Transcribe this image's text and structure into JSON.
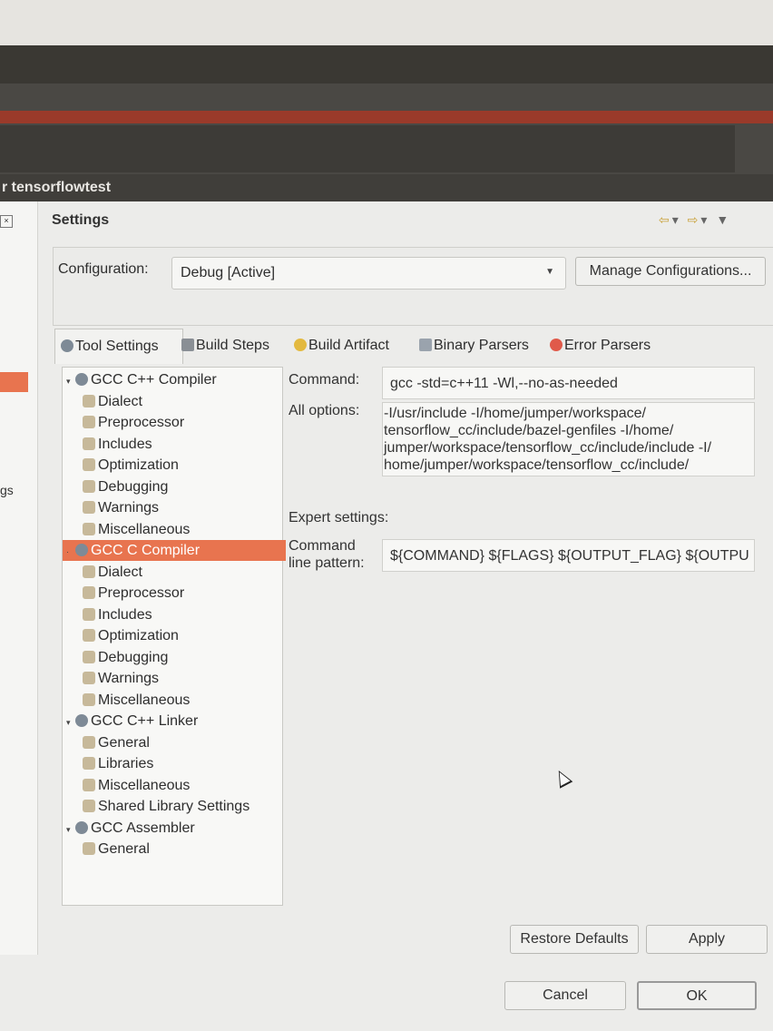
{
  "window": {
    "title": "r tensorflowtest"
  },
  "left_panel": {
    "partial_label": "gs"
  },
  "page": {
    "title": "Settings"
  },
  "configuration": {
    "label": "Configuration:",
    "value": "Debug [Active]",
    "manage_button": "Manage Configurations..."
  },
  "tabs": [
    {
      "label": "Tool Settings",
      "icon": "tool-settings-icon"
    },
    {
      "label": "Build Steps",
      "icon": "build-steps-icon"
    },
    {
      "label": "Build Artifact",
      "icon": "build-artifact-icon"
    },
    {
      "label": "Binary Parsers",
      "icon": "binary-parsers-icon"
    },
    {
      "label": "Error Parsers",
      "icon": "error-parsers-icon"
    }
  ],
  "tree": [
    {
      "label": "GCC C++ Compiler",
      "level": 0,
      "expanded": true
    },
    {
      "label": "Dialect",
      "level": 1
    },
    {
      "label": "Preprocessor",
      "level": 1
    },
    {
      "label": "Includes",
      "level": 1
    },
    {
      "label": "Optimization",
      "level": 1
    },
    {
      "label": "Debugging",
      "level": 1
    },
    {
      "label": "Warnings",
      "level": 1
    },
    {
      "label": "Miscellaneous",
      "level": 1
    },
    {
      "label": "GCC C Compiler",
      "level": 0,
      "selected": true
    },
    {
      "label": "Dialect",
      "level": 1
    },
    {
      "label": "Preprocessor",
      "level": 1
    },
    {
      "label": "Includes",
      "level": 1
    },
    {
      "label": "Optimization",
      "level": 1
    },
    {
      "label": "Debugging",
      "level": 1
    },
    {
      "label": "Warnings",
      "level": 1
    },
    {
      "label": "Miscellaneous",
      "level": 1
    },
    {
      "label": "GCC C++ Linker",
      "level": 0,
      "expanded": true
    },
    {
      "label": "General",
      "level": 1
    },
    {
      "label": "Libraries",
      "level": 1
    },
    {
      "label": "Miscellaneous",
      "level": 1
    },
    {
      "label": "Shared Library Settings",
      "level": 1
    },
    {
      "label": "GCC Assembler",
      "level": 0,
      "expanded": true
    },
    {
      "label": "General",
      "level": 1
    }
  ],
  "props": {
    "command_label": "Command:",
    "command_value": "gcc -std=c++11 -Wl,--no-as-needed",
    "all_options_label": "All options:",
    "all_options_lines": [
      "-I/usr/include -I/home/jumper/workspace/",
      "tensorflow_cc/include/bazel-genfiles -I/home/",
      "jumper/workspace/tensorflow_cc/include/include -I/",
      "home/jumper/workspace/tensorflow_cc/include/"
    ],
    "expert_label": "Expert settings:",
    "pattern_label_1": "Command",
    "pattern_label_2": "line pattern:",
    "pattern_value": "${COMMAND} ${FLAGS} ${OUTPUT_FLAG} ${OUTPU"
  },
  "buttons": {
    "restore_defaults": "Restore Defaults",
    "apply": "Apply",
    "cancel": "Cancel",
    "ok": "OK"
  },
  "colors": {
    "selection": "#e8744f",
    "titlebar": "#403e3a"
  }
}
